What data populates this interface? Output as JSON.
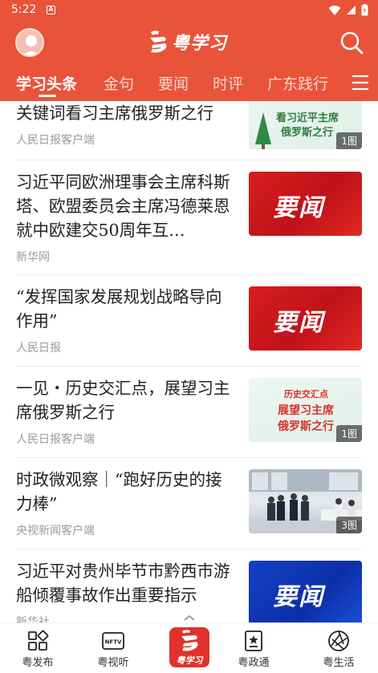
{
  "status": {
    "time": "5:22"
  },
  "header": {
    "logo_text": "粤学习"
  },
  "tabs": [
    {
      "label": "学习头条"
    },
    {
      "label": "金句"
    },
    {
      "label": "要闻"
    },
    {
      "label": "时评"
    },
    {
      "label": "广东践行"
    }
  ],
  "feed": [
    {
      "title": "关键词看习主席俄罗斯之行",
      "source": "人民日报客户端",
      "thumb_lines": [
        "看习近平主席",
        "俄罗斯之行"
      ],
      "badge": "1图"
    },
    {
      "title": "习近平同欧洲理事会主席科斯塔、欧盟委员会主席冯德莱恩就中欧建交50周年互…",
      "source": "新华网",
      "thumb_text": "要闻"
    },
    {
      "title": "“发挥国家发展规划战略导向作用”",
      "source": "人民日报",
      "thumb_text": "要闻"
    },
    {
      "title": "一见・历史交汇点，展望习主席俄罗斯之行",
      "source": "人民日报客户端",
      "thumb_lines": [
        "历史交汇点",
        "展望习主席",
        "俄罗斯之行"
      ],
      "badge": "1图"
    },
    {
      "title": "时政微观察｜“跑好历史的接力棒”",
      "source": "央视新闻客户端",
      "badge": "3图"
    },
    {
      "title": "习近平对贵州毕节市黔西市游船倾覆事故作出重要指示",
      "source": "新华社",
      "thumb_text": "要闻"
    }
  ],
  "bottom_nav": [
    {
      "label": "粤发布",
      "icon": "grid-icon"
    },
    {
      "label": "粤视听",
      "icon": "nftv-icon",
      "icon_text": "NFTV"
    },
    {
      "label": "粤学习",
      "icon": "yue-xuexi-logo-icon"
    },
    {
      "label": "粤政通",
      "icon": "star-card-icon"
    },
    {
      "label": "粤生活",
      "icon": "aperture-icon"
    }
  ],
  "colors": {
    "brand_red": "#e9533a",
    "news_red": "#d81e1e",
    "news_blue": "#1440c8"
  }
}
